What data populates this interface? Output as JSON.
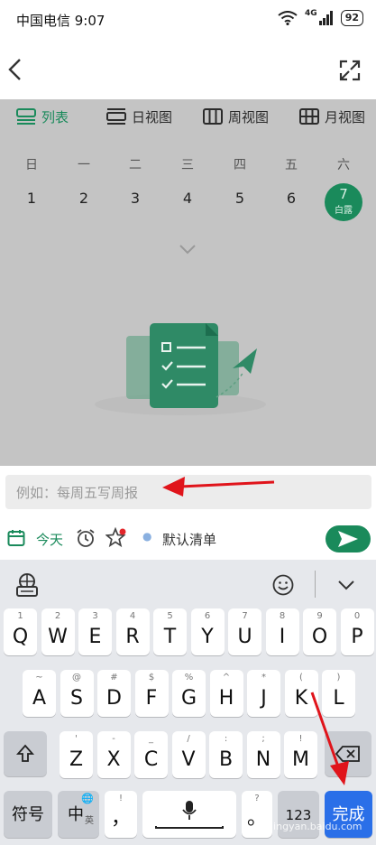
{
  "status_bar": {
    "carrier_time": "中国电信 9:07",
    "signal": "4G",
    "battery": "92"
  },
  "nav": {
    "back_icon": "back-arrow-icon",
    "expand_icon": "fullscreen-icon"
  },
  "view_tabs": [
    {
      "label": "列表",
      "icon": "list-icon"
    },
    {
      "label": "日视图",
      "icon": "day-view-icon"
    },
    {
      "label": "周视图",
      "icon": "week-view-icon"
    },
    {
      "label": "月视图",
      "icon": "month-view-icon"
    }
  ],
  "weekdays": [
    "日",
    "一",
    "二",
    "三",
    "四",
    "五",
    "六"
  ],
  "dates": [
    "1",
    "2",
    "3",
    "4",
    "5",
    "6"
  ],
  "today": {
    "day": "7",
    "term": "白露"
  },
  "input": {
    "placeholder": "例如：每周五写周报"
  },
  "toolbar": {
    "today_label": "今天",
    "list_label": "默认清单"
  },
  "keyboard": {
    "row1": [
      [
        "1",
        "Q"
      ],
      [
        "2",
        "W"
      ],
      [
        "3",
        "E"
      ],
      [
        "4",
        "R"
      ],
      [
        "5",
        "T"
      ],
      [
        "6",
        "Y"
      ],
      [
        "7",
        "U"
      ],
      [
        "8",
        "I"
      ],
      [
        "9",
        "O"
      ],
      [
        "0",
        "P"
      ]
    ],
    "row2": [
      [
        "~",
        "A"
      ],
      [
        "@",
        "S"
      ],
      [
        "#",
        "D"
      ],
      [
        "$",
        "F"
      ],
      [
        "%",
        "G"
      ],
      [
        "^",
        "H"
      ],
      [
        "*",
        "J"
      ],
      [
        "(",
        "K"
      ],
      [
        ")",
        "L"
      ]
    ],
    "row3": [
      [
        "'",
        "Z"
      ],
      [
        "-",
        "X"
      ],
      [
        "_",
        "C"
      ],
      [
        "/",
        "V"
      ],
      [
        ":",
        "B"
      ],
      [
        ";",
        "N"
      ],
      [
        "!",
        "M"
      ]
    ],
    "symbol_label": "符号",
    "lang_label": "中",
    "lang_sub": "英",
    "comma_top": "!",
    "comma_main": "，",
    "period_top": "?",
    "period_main": "。",
    "num_label": "123",
    "done_label": "完成"
  },
  "watermark": "jingyan.baidu.com",
  "colors": {
    "accent": "#1a8a5b",
    "arrow": "#e0141b",
    "done": "#2a6fe8"
  }
}
